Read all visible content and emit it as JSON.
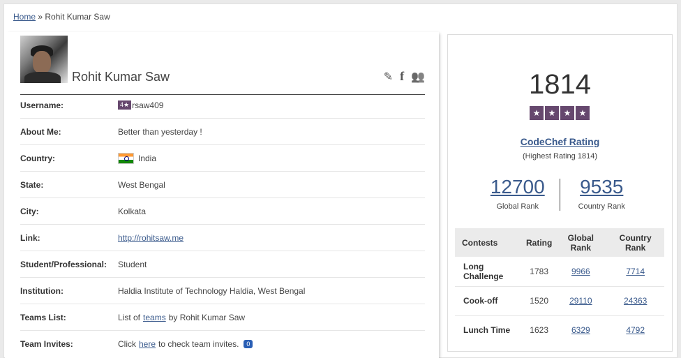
{
  "breadcrumb": {
    "home": "Home",
    "separator": "»",
    "current": "Rohit Kumar Saw"
  },
  "profile": {
    "name": "Rohit Kumar Saw",
    "actions": {
      "edit": "✎",
      "facebook": "f",
      "friends": "👥"
    }
  },
  "details": [
    {
      "label": "Username:",
      "badge": "4★",
      "value": "rsaw409"
    },
    {
      "label": "About Me:",
      "value": "Better than yesterday !"
    },
    {
      "label": "Country:",
      "value": "India"
    },
    {
      "label": "State:",
      "value": "West Bengal"
    },
    {
      "label": "City:",
      "value": "Kolkata"
    },
    {
      "label": "Link:",
      "value": "http://rohitsaw.me"
    },
    {
      "label": "Student/Professional:",
      "value": "Student"
    },
    {
      "label": "Institution:",
      "value": "Haldia Institute of Technology Haldia, West Bengal"
    },
    {
      "label": "Teams List:",
      "pre": "List of",
      "link": "teams",
      "post": "by Rohit Kumar Saw"
    },
    {
      "label": "Team Invites:",
      "pre": "Click",
      "link": "here",
      "post": "to check team invites.",
      "count": "0"
    }
  ],
  "rating": {
    "value": "1814",
    "stars": [
      "★",
      "★",
      "★",
      "★"
    ],
    "label": "CodeChef Rating",
    "highest": "(Highest Rating 1814)",
    "global_rank": "12700",
    "global_rank_label": "Global Rank",
    "country_rank": "9535",
    "country_rank_label": "Country Rank"
  },
  "contests": {
    "headers": [
      "Contests",
      "Rating",
      "Global Rank",
      "Country Rank"
    ],
    "rows": [
      {
        "name": "Long Challenge",
        "rating": "1783",
        "global": "9966",
        "country": "7714"
      },
      {
        "name": "Cook-off",
        "rating": "1520",
        "global": "29110",
        "country": "24363"
      },
      {
        "name": "Lunch Time",
        "rating": "1623",
        "global": "6329",
        "country": "4792"
      }
    ]
  },
  "colors": {
    "link": "#3a5a8c",
    "star_badge": "#66486e",
    "invite_badge": "#2a5fb5"
  }
}
